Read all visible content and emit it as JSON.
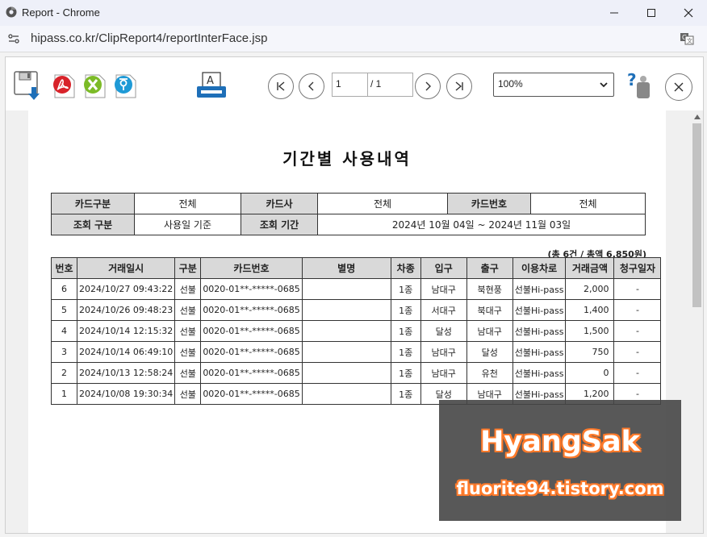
{
  "window": {
    "title": "Report - Chrome",
    "url": "hipass.co.kr/ClipReport4/reportInterFace.jsp"
  },
  "toolbar": {
    "page_current": "1",
    "page_total": "/ 1",
    "zoom": "100%",
    "icons": [
      "save-icon",
      "pdf-export-icon",
      "excel-export-icon",
      "hwp-export-icon",
      "print-icon",
      "first-page-icon",
      "prev-page-icon",
      "next-page-icon",
      "last-page-icon",
      "help-icon",
      "close-icon"
    ]
  },
  "report": {
    "title": "기간별 사용내역",
    "criteria": {
      "row1": [
        {
          "label": "카드구분",
          "value": "전체"
        },
        {
          "label": "카드사",
          "value": "전체"
        },
        {
          "label": "카드번호",
          "value": "전체"
        }
      ],
      "row2": [
        {
          "label": "조회 구분",
          "value": "사용일 기준"
        },
        {
          "label": "조회 기간",
          "value": "2024년 10월 04일 ~ 2024년 11월 03일"
        }
      ]
    },
    "summary": "(총 6건 / 총액 6,850원)",
    "columns": [
      "번호",
      "거래일시",
      "구분",
      "카드번호",
      "별명",
      "차종",
      "입구",
      "출구",
      "이용차로",
      "거래금액",
      "청구일자"
    ],
    "rows": [
      [
        "6",
        "2024/10/27 09:43:22",
        "선불",
        "0020-01**-*****-0685",
        "",
        "1종",
        "남대구",
        "북현풍",
        "선불Hi-pass",
        "2,000",
        "-"
      ],
      [
        "5",
        "2024/10/26 09:48:23",
        "선불",
        "0020-01**-*****-0685",
        "",
        "1종",
        "서대구",
        "북대구",
        "선불Hi-pass",
        "1,400",
        "-"
      ],
      [
        "4",
        "2024/10/14 12:15:32",
        "선불",
        "0020-01**-*****-0685",
        "",
        "1종",
        "달성",
        "남대구",
        "선불Hi-pass",
        "1,500",
        "-"
      ],
      [
        "3",
        "2024/10/14 06:49:10",
        "선불",
        "0020-01**-*****-0685",
        "",
        "1종",
        "남대구",
        "달성",
        "선불Hi-pass",
        "750",
        "-"
      ],
      [
        "2",
        "2024/10/13 12:58:24",
        "선불",
        "0020-01**-*****-0685",
        "",
        "1종",
        "남대구",
        "유천",
        "선불Hi-pass",
        "0",
        "-"
      ],
      [
        "1",
        "2024/10/08 19:30:34",
        "선불",
        "0020-01**-*****-0685",
        "",
        "1종",
        "달성",
        "남대구",
        "선불Hi-pass",
        "1,200",
        "-"
      ]
    ]
  },
  "watermark": {
    "title": "HyangSak",
    "url": "fluorite94.tistory.com"
  },
  "colors": {
    "titlebar": "#eef0f9",
    "header_cell": "#d9d9d9",
    "watermark_outline": "#ff7a2a",
    "print_icon_blue": "#1e6fb8"
  }
}
